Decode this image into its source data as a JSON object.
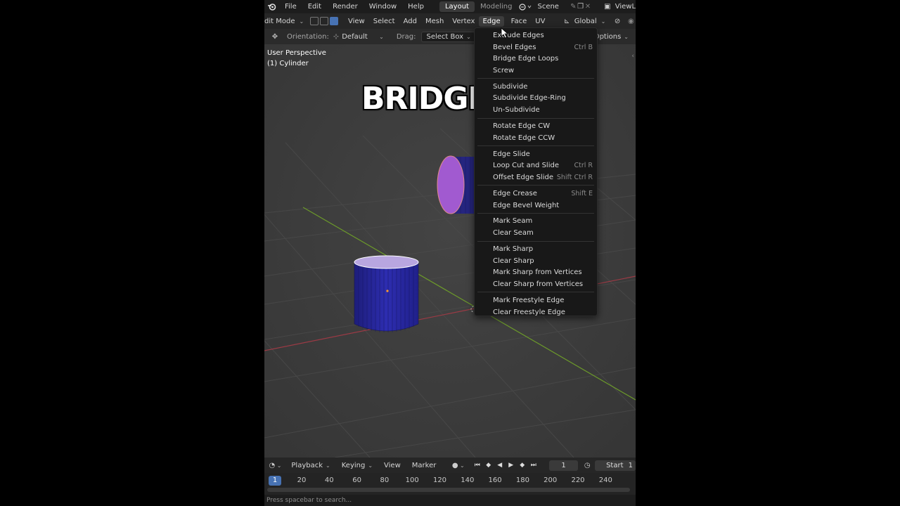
{
  "topbar": {
    "menu": [
      "File",
      "Edit",
      "Render",
      "Window",
      "Help"
    ],
    "workspace_tabs": [
      "Layout",
      "Modeling"
    ],
    "active_tab": "Layout",
    "scene_name": "Scene",
    "view_layer": "ViewL"
  },
  "header": {
    "mode": "dit Mode",
    "menu": [
      "View",
      "Select",
      "Add",
      "Mesh",
      "Vertex",
      "Edge",
      "Face",
      "UV"
    ],
    "active_menu": "Edge",
    "transform_space": "Global"
  },
  "tool_header": {
    "orientation_label": "Orientation:",
    "orientation_value": "Default",
    "drag_label": "Drag:",
    "drag_value": "Select Box",
    "options_label": "Options"
  },
  "viewport": {
    "perspective_label": "User Perspective",
    "object_label": "(1) Cylinder",
    "overlay_title": "BRIDGE"
  },
  "edge_menu": {
    "groups": [
      [
        {
          "label": "Extrude Edges",
          "shortcut": ""
        },
        {
          "label": "Bevel Edges",
          "shortcut": "Ctrl B"
        },
        {
          "label": "Bridge Edge Loops",
          "shortcut": ""
        },
        {
          "label": "Screw",
          "shortcut": ""
        }
      ],
      [
        {
          "label": "Subdivide",
          "shortcut": ""
        },
        {
          "label": "Subdivide Edge-Ring",
          "shortcut": ""
        },
        {
          "label": "Un-Subdivide",
          "shortcut": ""
        }
      ],
      [
        {
          "label": "Rotate Edge CW",
          "shortcut": ""
        },
        {
          "label": "Rotate Edge CCW",
          "shortcut": ""
        }
      ],
      [
        {
          "label": "Edge Slide",
          "shortcut": ""
        },
        {
          "label": "Loop Cut and Slide",
          "shortcut": "Ctrl R"
        },
        {
          "label": "Offset Edge Slide",
          "shortcut": "Shift Ctrl R"
        }
      ],
      [
        {
          "label": "Edge Crease",
          "shortcut": "Shift E"
        },
        {
          "label": "Edge Bevel Weight",
          "shortcut": ""
        }
      ],
      [
        {
          "label": "Mark Seam",
          "shortcut": ""
        },
        {
          "label": "Clear Seam",
          "shortcut": ""
        }
      ],
      [
        {
          "label": "Mark Sharp",
          "shortcut": ""
        },
        {
          "label": "Clear Sharp",
          "shortcut": ""
        },
        {
          "label": "Mark Sharp from Vertices",
          "shortcut": ""
        },
        {
          "label": "Clear Sharp from Vertices",
          "shortcut": ""
        }
      ],
      [
        {
          "label": "Mark Freestyle Edge",
          "shortcut": ""
        },
        {
          "label": "Clear Freestyle Edge",
          "shortcut": ""
        }
      ]
    ]
  },
  "timeline": {
    "playback_label": "Playback",
    "keying_label": "Keying",
    "view_label": "View",
    "marker_label": "Marker",
    "current_frame": "1",
    "start_label": "Start",
    "start_value": "1",
    "ruler_ticks": [
      "20",
      "40",
      "60",
      "80",
      "100",
      "120",
      "140",
      "160",
      "180",
      "200",
      "220",
      "240"
    ]
  },
  "status_bar": {
    "text": "Press spacebar to search..."
  },
  "colors": {
    "accent": "#4772b3",
    "mesh_blue": "#2a2a9c",
    "selected_face": "#a15ad0",
    "x_axis": "#9c3a45",
    "y_axis": "#6c9a2a"
  }
}
